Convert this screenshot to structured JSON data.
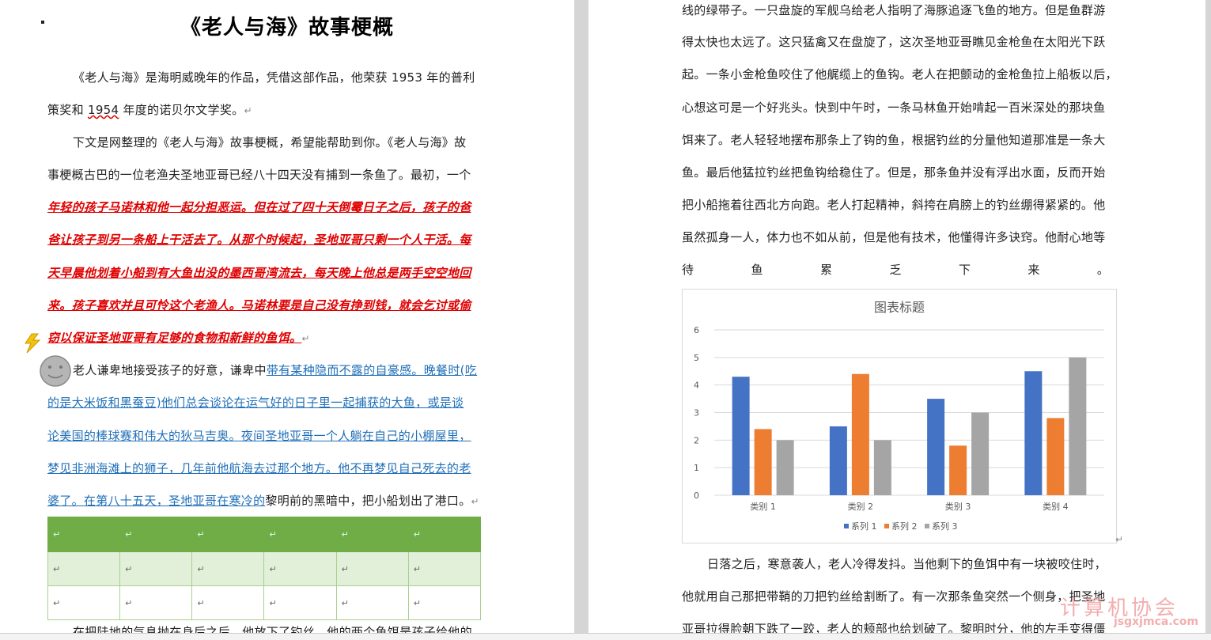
{
  "doc": {
    "title": "《老人与海》故事梗概",
    "p1": [
      "《老人与海》是海明威晚年的作品，凭借这部作品，他荣获 1953 年的普利",
      "策奖和",
      "1954",
      " 年度的诺贝尔文学奖。"
    ],
    "p2_l1": "下文是网整理的《老人与海》故事梗概，希望能帮助到你。《老人与海》故",
    "p2_l2": "事梗概古巴的一位老渔夫圣地亚哥已经八十四天没有捕到一条鱼了。最初，一个",
    "red_lines": [
      "年轻的孩子马诺林和他一起分担恶运。但在过了四十天倒霉日子之后，孩子的爸",
      "爸让孩子到另一条船上干活去了。从那个时候起，圣地亚哥只剩一个人干活。每",
      "天早晨他划着小船到有大鱼出没的墨西哥湾流去，每天晚上他总是两手空空地回",
      "来。孩子喜欢并且可怜这个老渔人。马诺林要是自己没有挣到钱，就会乞讨或偷",
      "窃以保证圣地亚哥有足够的食物和新鲜的鱼饵。"
    ],
    "p3_l1_plain": "老人谦卑地接受孩子的好意，谦卑中",
    "p3_l1_blue": "带有某种隐而不露的自豪感。晚餐时(吃",
    "blue_lines": [
      "的是大米饭和黑蚕豆)他们总会谈论在运气好的日子里一起捕获的大鱼，或是谈",
      "论美国的棒球赛和伟大的狄马吉奥。夜间圣地亚哥一个人躺在自己的小棚屋里，",
      "梦见非洲海滩上的狮子，几年前他航海去过那个地方。他不再梦见自己死去的老"
    ],
    "p3_last_blue": "婆了。在第八十五天，圣地亚哥在寒冷的",
    "p3_last_plain": "黎明前的黑暗中，把小船划出了港口。",
    "p4_cut": "在把陆地的气息抛在身后之后，他放下了钓丝。他的两个鱼饵是孩子给他的",
    "para_mark": "↵",
    "right_lines": [
      "线的绿带子。一只盘旋的军舰乌给老人指明了海豚追逐飞鱼的地方。但是鱼群游",
      "得太快也太远了。这只猛禽又在盘旋了，这次圣地亚哥瞧见金枪鱼在太阳光下跃",
      "起。一条小金枪鱼咬住了他艉缆上的鱼钩。老人在把颤动的金枪鱼拉上船板以后，",
      "心想这可是一个好兆头。快到中午时，一条马林鱼开始啃起一百米深处的那块鱼",
      "饵来了。老人轻轻地摆布那条上了钩的鱼，根据钓丝的分量他知道那准是一条大",
      "鱼。最后他猛拉钓丝把鱼钩给稳住了。但是，那条鱼并没有浮出水面，反而开始",
      "把小船拖着往西北方向跑。老人打起精神，斜挎在肩膀上的钓丝绷得紧紧的。他",
      "虽然孤身一人，体力也不如从前，但是他有技术，他懂得许多诀窍。他耐心地等"
    ],
    "spread_line": [
      "待",
      "鱼",
      "累",
      "乏",
      "下",
      "来",
      "。"
    ],
    "after_chart": [
      "日落之后，寒意袭人，老人冷得发抖。当他剩下的鱼饵中有一块被咬住时，",
      "他就用自己那把带鞘的刀把钓丝给割断了。有一次那条鱼突然一个侧身，把圣地",
      "亚哥拉得脸朝下跌了一跤，老人的颊部也给划破了。黎明时分，他的左手变得僵"
    ],
    "watermark": "计算机协会",
    "watermark_url": "jsgxjmca.com"
  },
  "table": {
    "rows": 3,
    "cols": 6,
    "cell_mark": "↵"
  },
  "chart_data": {
    "type": "bar",
    "title": "图表标题",
    "categories": [
      "类别 1",
      "类别 2",
      "类别 3",
      "类别 4"
    ],
    "series": [
      {
        "name": "系列 1",
        "values": [
          4.3,
          2.5,
          3.5,
          4.5
        ],
        "color": "#4472c4"
      },
      {
        "name": "系列 2",
        "values": [
          2.4,
          4.4,
          1.8,
          2.8
        ],
        "color": "#ed7d31"
      },
      {
        "name": "系列 3",
        "values": [
          2,
          2,
          3,
          5
        ],
        "color": "#a5a5a5"
      }
    ],
    "ylim": [
      0,
      6
    ],
    "yticks": [
      "0",
      "1",
      "2",
      "3",
      "4",
      "5",
      "6"
    ],
    "grid": true,
    "legend_position": "bottom"
  }
}
